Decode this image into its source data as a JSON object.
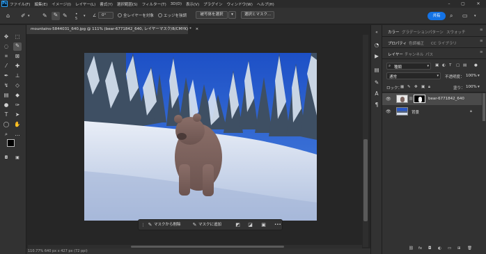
{
  "menubar": {
    "logo": "Ps",
    "items": [
      "ファイル(F)",
      "編集(E)",
      "イメージ(I)",
      "レイヤー(L)",
      "書式(Y)",
      "選択範囲(S)",
      "フィルター(T)",
      "3D(D)",
      "表示(V)",
      "プラグイン",
      "ウィンドウ(W)",
      "ヘルプ(H)"
    ],
    "window_controls": [
      "–",
      "▢",
      "✕"
    ]
  },
  "options": {
    "tolerance_label": "5",
    "angle_value": "0°",
    "sample_all_layers": "全レイヤーを対象",
    "enhance_edge": "エッジを強調",
    "select_subject": "被写体を選択",
    "select_mask": "選択とマスク...",
    "share": "共有"
  },
  "document": {
    "tab_title": "mountains-5844031_640.jpg @ 111% (bear-6771842_640, レイヤーマスク/8/CMYK) *",
    "tab_close": "×",
    "status": "110.77%     640 px x 427 px (72 ppi)"
  },
  "context_bar": {
    "subtract": "マスクから削除",
    "add": "マスクに追加",
    "more": "•••"
  },
  "panels": {
    "top_tabs": [
      "カラー",
      "グラデーション",
      "パターン",
      "スウォッチ"
    ],
    "mid_tabs": [
      "プロパティ",
      "色調補正",
      "CC ライブラリ"
    ],
    "layer_tabs": [
      "レイヤー",
      "チャンネル",
      "パス"
    ],
    "filter_kind": "種類",
    "blend_mode": "通常",
    "opacity_label": "不透明度：",
    "opacity_value": "100%",
    "lock_label": "ロック：",
    "fill_label": "塗り：",
    "fill_value": "100%",
    "layers": [
      {
        "name": "bear-6771842_640",
        "selected": true
      },
      {
        "name": "背景",
        "selected": false
      }
    ]
  },
  "colors": {
    "accent": "#1473e6",
    "panel": "#323232",
    "background": "#262626"
  }
}
